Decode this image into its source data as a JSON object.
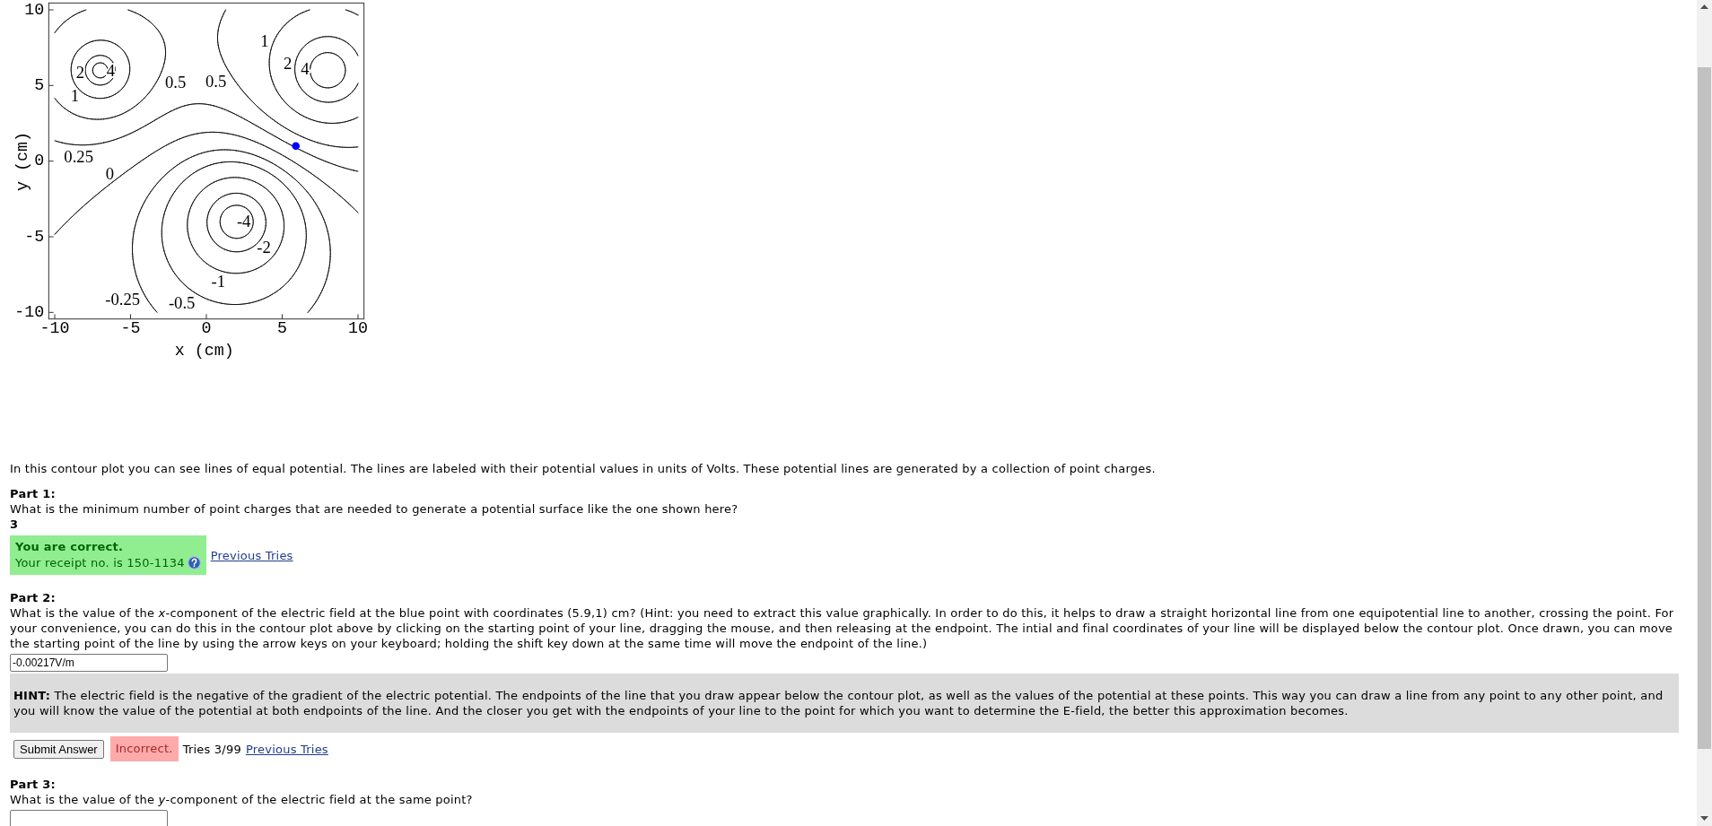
{
  "contour_plot": {
    "y_axis_title": "y (cm)",
    "x_axis_title": "x (cm)",
    "y_ticks": [
      "10",
      "5",
      "0",
      "-5",
      "-10"
    ],
    "x_ticks": [
      "-10",
      "-5",
      "0",
      "5",
      "10"
    ],
    "contour_labels": [
      "1",
      "2",
      "4",
      "2",
      "4",
      "0.5",
      "0.5",
      "1",
      "0.25",
      "0",
      "-4",
      "-2",
      "-1",
      "-0.25",
      "-0.5"
    ]
  },
  "intro": "In this contour plot you can see lines of equal potential. The lines are labeled with their potential values in units of Volts. These potential lines are generated by a collection of point charges.",
  "parts": [
    {
      "title": "Part 1:",
      "question": "What is the minimum number of point charges that are needed to generate a potential surface like the one shown here?",
      "answer": {
        "kind": "text",
        "value": "3"
      },
      "result": {
        "kind": "correct",
        "title": "You are correct.",
        "receipt": "Your receipt no. is 150-1134"
      },
      "previous_tries_link": "Previous Tries"
    },
    {
      "title": "Part 2:",
      "question": "What is the value of the *x*-component of the electric field at the blue point with coordinates (5.9,1) cm? (Hint: you need to extract this value graphically. In order to do this, it helps to draw a straight horizontal line from one equipotential line to another, crossing the point. For your convenience, you can do this in the contour plot above by clicking on the starting point of your line, dragging the mouse, and then releasing at the endpoint. The intial and final coordinates of your line will be displayed below the contour plot. Once drawn, you can move the starting point of the line by using the arrow keys on your keyboard; holding the shift key down at the same time will move the endpoint of the line.)",
      "answer": {
        "kind": "input",
        "value": "-0.00217V/m"
      },
      "hint": {
        "text": "**HINT:** The electric field is the negative of the gradient of the electric potential. The endpoints of the line that you draw appear below the contour plot, as well as the values of the potential at these points. This way you can draw a line from any point to any other point, and you will know the value of the potential at both endpoints of the line. And the closer you get with the endpoints of your line to the point for which you want to determine the E-field, the better this approximation becomes."
      },
      "submit_button": "Submit Answer",
      "result": {
        "kind": "incorrect",
        "title": "Incorrect."
      },
      "tries": "Tries 3/99",
      "previous_tries_link": "Previous Tries"
    },
    {
      "title": "Part 3:",
      "question": "What is the value of the *y*-component of the electric field at the same point?",
      "answer": {
        "kind": "input"
      }
    }
  ]
}
